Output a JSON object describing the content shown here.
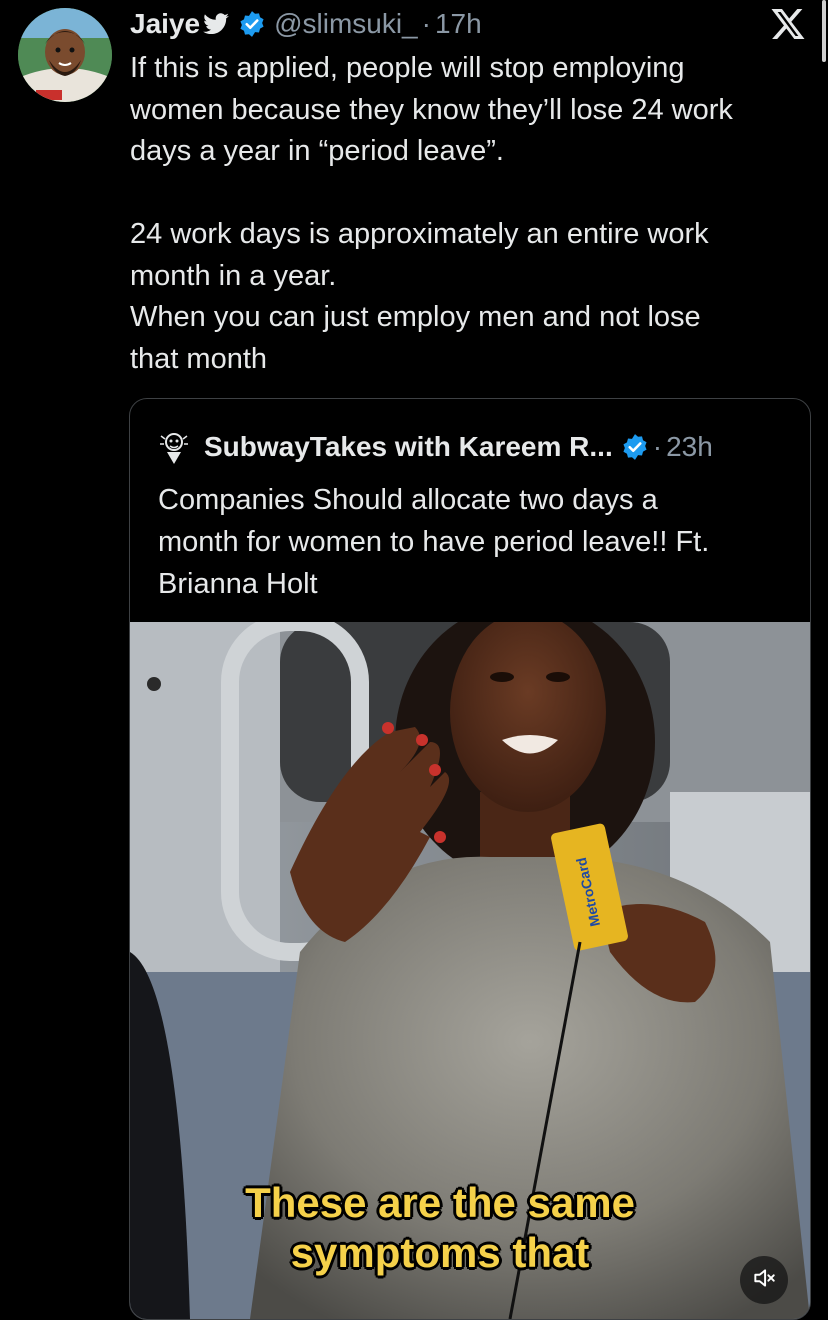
{
  "tweet": {
    "author_name": "Jaiye",
    "handle": "@slimsuki_",
    "separator": "·",
    "time": "17h",
    "text_lines": [
      "If this is applied, people will stop employing",
      "women because they know they’ll lose 24 work",
      "days a year in “period leave”.",
      "",
      "24 work days is approximately an entire work",
      "month in a year.",
      "When you can just employ men and not lose",
      "that month"
    ]
  },
  "quote": {
    "author_name": "SubwayTakes with Kareem R...",
    "separator": "·",
    "time": "23h",
    "text_lines": [
      "Companies Should allocate two days a",
      "month for women to have period leave!! Ft.",
      "Brianna Holt"
    ],
    "video": {
      "caption_lines": [
        "These are the same",
        "symptoms that"
      ],
      "card_text": "MetroCard"
    }
  },
  "colors": {
    "background": "#000000",
    "text": "#e7e9ea",
    "secondary_text": "#8b98a5",
    "verified_blue": "#1d9bf0",
    "caption_yellow": "#f5d14a"
  },
  "icons": [
    "avatar",
    "bird-icon",
    "verified-icon",
    "x-logo-icon",
    "close-icon",
    "mute-icon"
  ]
}
